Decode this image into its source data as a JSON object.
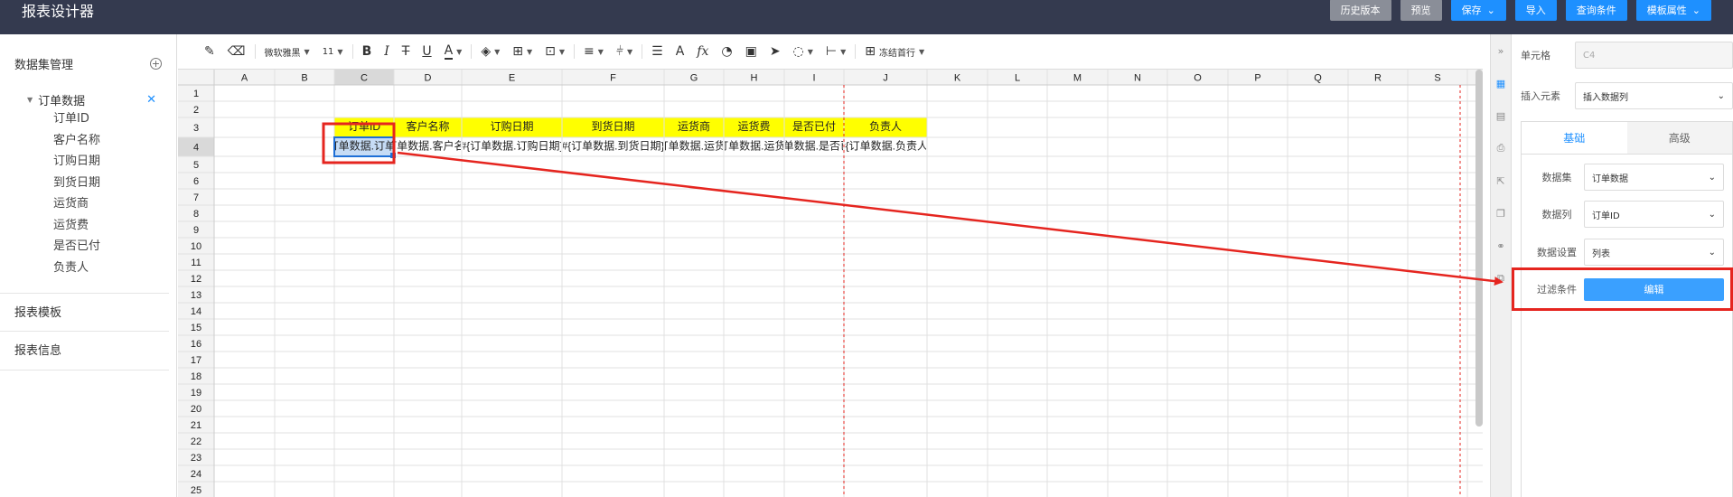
{
  "app": {
    "title": "报表设计器"
  },
  "header": {
    "buttons": [
      "历史版本",
      "预览",
      "保存",
      "导入",
      "查询条件",
      "模板属性"
    ]
  },
  "sidebar": {
    "title": "数据集管理",
    "dataset": "订单数据",
    "fields": [
      "订单ID",
      "客户名称",
      "订购日期",
      "到货日期",
      "运货商",
      "运货费",
      "是否已付",
      "负责人"
    ],
    "sections": [
      "报表模板",
      "报表信息"
    ]
  },
  "toolbar": {
    "font": "微软雅黑",
    "size": "11",
    "freeze": "冻结首行"
  },
  "sheet": {
    "columns": [
      "A",
      "B",
      "C",
      "D",
      "E",
      "F",
      "G",
      "H",
      "I",
      "J",
      "K",
      "L",
      "M",
      "N",
      "O",
      "P",
      "Q",
      "R",
      "S"
    ],
    "rows": [
      "1",
      "2",
      "3",
      "4",
      "5",
      "6",
      "7",
      "8",
      "9",
      "10",
      "11",
      "12",
      "13",
      "14",
      "15",
      "16",
      "17",
      "18",
      "19",
      "20",
      "21",
      "22",
      "23",
      "24",
      "25"
    ],
    "header_row": [
      "订单ID",
      "客户名称",
      "订购日期",
      "到货日期",
      "运货商",
      "运货费",
      "是否已付",
      "负责人"
    ],
    "data_row": [
      "#{订单数据.订单ID}",
      "#{订单数据.客户名称}",
      "#{订单数据.订购日期}",
      "#{订单数据.到货日期}",
      "#{订单数据.运货商}",
      "#{订单数据.运货费}",
      "#{订单数据.是否已付}",
      "#{订单数据.负责人}"
    ],
    "header_fill": "#ffff00",
    "selected_fill": "#c6dcf5"
  },
  "right_panel": {
    "cell_label": "单元格",
    "cell_value": "C4",
    "insert_label": "插入元素",
    "insert_value": "插入数据列",
    "tabs": [
      "基础",
      "高级"
    ],
    "dataset_label": "数据集",
    "dataset_value": "订单数据",
    "column_label": "数据列",
    "column_value": "订单ID",
    "setting_label": "数据设置",
    "setting_value": "列表",
    "filter_label": "过滤条件",
    "edit_label": "编辑"
  },
  "colors": {
    "topbar": "#343a4f",
    "accent": "#1e90ff",
    "highlight": "#e5251f"
  }
}
